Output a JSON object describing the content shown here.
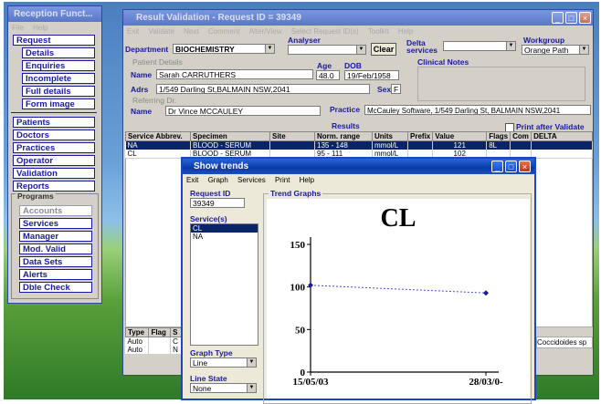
{
  "reception": {
    "title": "Reception Funct...",
    "menu": [
      "File",
      "Help"
    ],
    "buttons": [
      "Request",
      "Patients",
      "Doctors",
      "Practices",
      "Operator",
      "Validation",
      "Reports"
    ],
    "request_sub": [
      "Details",
      "Enquiries",
      "Incomplete",
      "Full details",
      "Form image"
    ],
    "programs_label": "Programs",
    "programs": [
      "Accounts",
      "Services",
      "Manager",
      "Mod. Valid",
      "Data Sets",
      "Alerts",
      "Dble Check"
    ]
  },
  "result": {
    "title": "Result Validation - Request ID = 39349",
    "menu": [
      "Exit",
      "Validate",
      "Next",
      "Comment",
      "Alter/View",
      "Select Request ID(s)",
      "Toolkit",
      "Help"
    ],
    "department_label": "Department",
    "department_value": "BIOCHEMISTRY",
    "analyser_label": "Analyser",
    "analyser_value": "",
    "clear_label": "Clear",
    "delta_services_label": "Delta services",
    "workgroup_label": "Workgroup",
    "workgroup_value": "Orange Path",
    "patient_details_label": "Patient Details",
    "name_label": "Name",
    "patient_name": "Sarah CARRUTHERS",
    "age_label": "Age",
    "age_value": "48.0",
    "dob_label": "DOB",
    "dob_value": "19/Feb/1958",
    "adrs_label": "Adrs",
    "address": "1/549 Darling St,BALMAIN NSW,2041",
    "sex_label": "Sex",
    "sex_value": "F",
    "clinical_notes_label": "Clinical Notes",
    "referring_label": "Referring Dr.",
    "dr_name_label": "Name",
    "dr_name": "Dr Vince MCCAULEY",
    "practice_label": "Practice",
    "practice_value": "McCauley Software, 1/549 Darling St, BALMAIN NSW,2041",
    "results_label": "Results",
    "print_after_label": "Print after Validate",
    "columns": [
      "Service Abbrev.",
      "Specimen",
      "Site",
      "Norm. range",
      "Units",
      "Prefix",
      "Value",
      "Flags",
      "Com",
      "DELTA"
    ],
    "rows": [
      [
        "NA",
        "BLOOD - SERUM",
        "",
        "135 - 148",
        "mmol/L",
        "",
        "121",
        "8L",
        "",
        ""
      ],
      [
        "CL",
        "BLOOD - SERUM",
        "",
        "95 - 111",
        "mmol/L",
        "",
        "102",
        "",
        "",
        ""
      ]
    ],
    "bottom_columns": [
      "Type",
      "Flag",
      "S"
    ],
    "bottom_rows": [
      [
        "Auto",
        "",
        "C"
      ],
      [
        "Auto",
        "",
        "N"
      ]
    ],
    "bottom_right_text": "Coccidoides sp"
  },
  "trends": {
    "title": "Show trends",
    "menu": [
      "Exit",
      "Graph",
      "Services",
      "Print",
      "Help"
    ],
    "request_id_label": "Request ID",
    "request_id_value": "39349",
    "services_label": "Service(s)",
    "services": [
      "CL",
      "NA"
    ],
    "graph_type_label": "Graph Type",
    "graph_type_value": "Line",
    "line_state_label": "Line State",
    "line_state_value": "None",
    "trend_graphs_label": "Trend Graphs"
  },
  "chart_data": {
    "type": "line",
    "title": "CL",
    "x": [
      "15/05/03",
      "28/03/0-"
    ],
    "series": [
      {
        "values": [
          102,
          93
        ]
      }
    ],
    "yticks": [
      0,
      50,
      100,
      150
    ],
    "ylim": [
      0,
      150
    ],
    "grid": false,
    "marker_color": "#1a1aa0",
    "line_color": "#4a4ac0"
  }
}
